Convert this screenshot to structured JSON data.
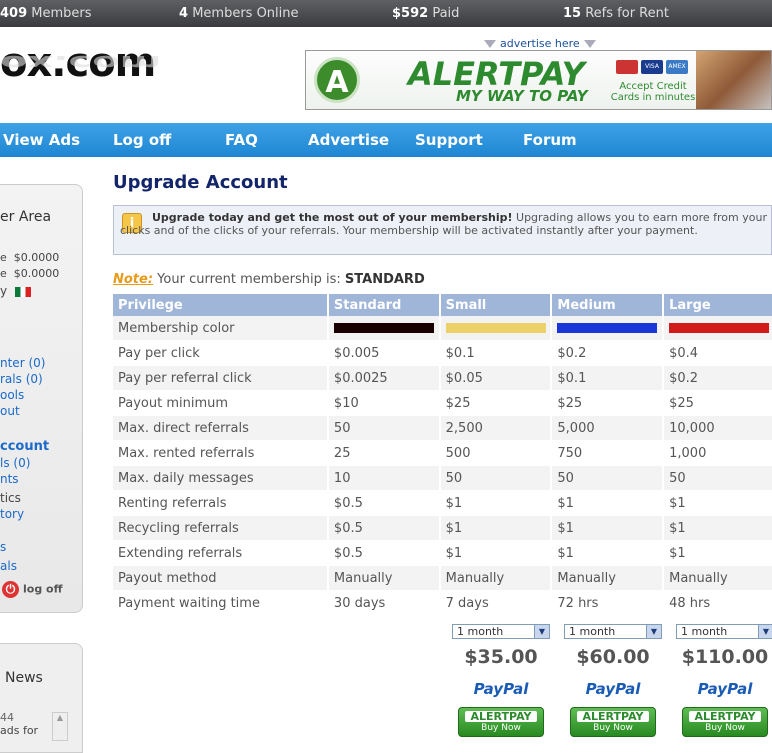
{
  "topbar": {
    "members_num": "409",
    "members_label": "Members",
    "online_num": "4",
    "online_label": "Members Online",
    "paid_num": "$592",
    "paid_label": "Paid",
    "refs_num": "15",
    "refs_label": "Refs for Rent"
  },
  "site": {
    "logo": "ox.com",
    "advertise_here": "advertise here"
  },
  "banner": {
    "brand": "ALERTPAY",
    "tagline": "MY WAY TO PAY",
    "accept": "Accept Credit Cards in minutes",
    "cards": [
      "",
      "VISA",
      "AMEX"
    ]
  },
  "nav": [
    "View Ads",
    "Log off",
    "FAQ",
    "Advertise",
    "Support",
    "Forum"
  ],
  "sidebar": {
    "heading": "er Area",
    "bal1_label": "e",
    "bal1_value": "$0.0000",
    "bal2_label": "e",
    "bal2_value": "$0.0000",
    "flag_label": "y",
    "links": [
      "nter (0)",
      "rals (0)",
      "ools",
      "out"
    ],
    "account_heading": "ccount",
    "links2": [
      "ls (0)",
      "nts"
    ],
    "static1": "tics",
    "links3": [
      "tory"
    ],
    "links4": [
      "s",
      "als"
    ],
    "logoff": "log off",
    "news_heading": "News",
    "news_count": "44",
    "news_text": "ads for"
  },
  "main": {
    "title": "Upgrade Account",
    "notice_bold": "Upgrade today and get the most out of your membership!",
    "notice_text": " Upgrading allows you to earn more from your clicks and of the clicks of your referrals. Your membership will be activated instantly after your payment.",
    "note_label": "Note:",
    "note_text": " Your current membership is: ",
    "current_membership": "STANDARD"
  },
  "table": {
    "headers": [
      "Privilege",
      "Standard",
      "Small",
      "Medium",
      "Large"
    ],
    "color_row_label": "Membership color",
    "colors": [
      "#1a0000",
      "#ecd168",
      "#1c35d8",
      "#d11a1a"
    ],
    "rows": [
      [
        "Pay per click",
        "$0.005",
        "$0.1",
        "$0.2",
        "$0.4"
      ],
      [
        "Pay per referral click",
        "$0.0025",
        "$0.05",
        "$0.1",
        "$0.2"
      ],
      [
        "Payout minimum",
        "$10",
        "$25",
        "$25",
        "$25"
      ],
      [
        "Max. direct referrals",
        "50",
        "2,500",
        "5,000",
        "10,000"
      ],
      [
        "Max. rented referrals",
        "25",
        "500",
        "750",
        "1,000"
      ],
      [
        "Max. daily messages",
        "10",
        "50",
        "50",
        "50"
      ],
      [
        "Renting referrals",
        "$0.5",
        "$1",
        "$1",
        "$1"
      ],
      [
        "Recycling referrals",
        "$0.5",
        "$1",
        "$1",
        "$1"
      ],
      [
        "Extending referrals",
        "$0.5",
        "$1",
        "$1",
        "$1"
      ],
      [
        "Payout method",
        "Manually",
        "Manually",
        "Manually",
        "Manually"
      ],
      [
        "Payment waiting time",
        "30 days",
        "7 days",
        "72 hrs",
        "48 hrs"
      ]
    ]
  },
  "plans": [
    {
      "period": "1 month",
      "price": "$35.00",
      "paypal": "PayPal",
      "alertpay": "ALERTPAY",
      "buy": "Buy Now"
    },
    {
      "period": "1 month",
      "price": "$60.00",
      "paypal": "PayPal",
      "alertpay": "ALERTPAY",
      "buy": "Buy Now"
    },
    {
      "period": "1 month",
      "price": "$110.00",
      "paypal": "PayPal",
      "alertpay": "ALERTPAY",
      "buy": "Buy Now"
    }
  ]
}
